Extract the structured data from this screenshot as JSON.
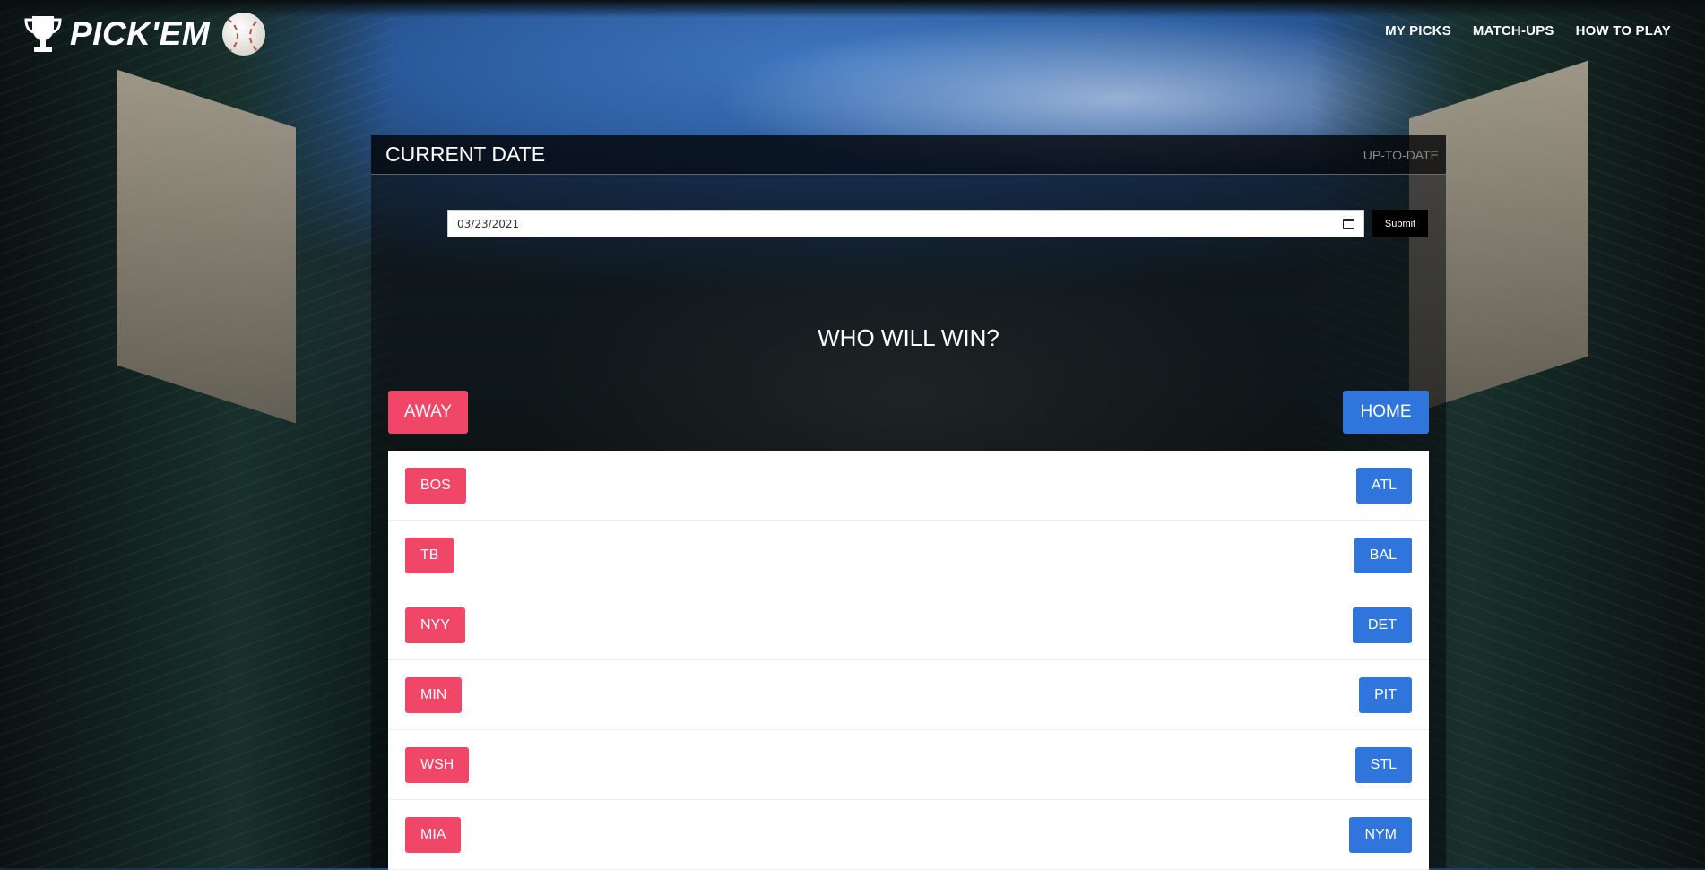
{
  "header": {
    "logo_text": "PICK'EM",
    "logo_icons": [
      "trophy-icon",
      "baseball-icon"
    ],
    "nav": [
      "MY PICKS",
      "MATCH-UPS",
      "HOW TO PLAY"
    ]
  },
  "panel": {
    "title": "CURRENT DATE",
    "status": "UP-TO-DATE",
    "date_value": "03/23/2021",
    "submit_label": "Submit",
    "question": "WHO WILL WIN?",
    "away_label": "AWAY",
    "home_label": "HOME"
  },
  "games": [
    {
      "away": "BOS",
      "home": "ATL"
    },
    {
      "away": "TB",
      "home": "BAL"
    },
    {
      "away": "NYY",
      "home": "DET"
    },
    {
      "away": "MIN",
      "home": "PIT"
    },
    {
      "away": "WSH",
      "home": "STL"
    },
    {
      "away": "MIA",
      "home": "NYM"
    }
  ],
  "colors": {
    "away": "#f04668",
    "home": "#3075dc"
  }
}
